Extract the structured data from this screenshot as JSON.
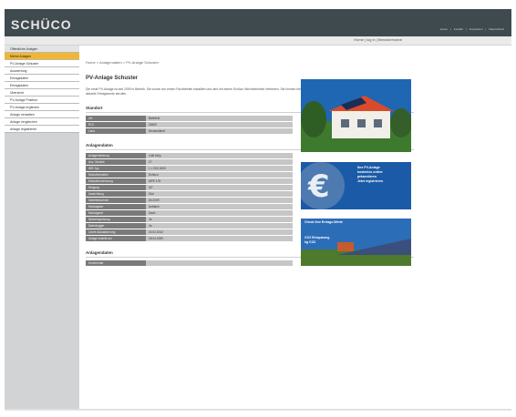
{
  "brand": {
    "logo": "SCHÜCO"
  },
  "header": {
    "topnav": [
      "Home",
      "Kontakt",
      "Impressum",
      "Datenschutz"
    ],
    "user_info": "Home | log in | Benutzername"
  },
  "sidebar": {
    "items": [
      {
        "label": "Öffentliche Anlagen",
        "active": false
      },
      {
        "label": "Meine Anlagen",
        "active": true
      },
      {
        "label": "PV-Anlage Schuster",
        "active": false
      },
      {
        "label": "Auswertung",
        "active": false
      },
      {
        "label": "Ertragsdaten",
        "active": false
      },
      {
        "label": "Ertragsdaten",
        "active": false
      },
      {
        "label": "Übersicht",
        "active": false
      },
      {
        "label": "PV-Anlage Position",
        "active": false
      },
      {
        "label": "PV-Anlage ergänzen",
        "active": false
      },
      {
        "label": "Anlage verwalten",
        "active": false
      },
      {
        "label": "Anlage vergleichen",
        "active": false
      },
      {
        "label": "Anlage registrieren",
        "active": false
      }
    ]
  },
  "breadcrumb": "Home > Anlagendaten > PV-Anlage Schuster",
  "page_title": "PV-Anlage Schuster",
  "intro": "Die erste PV-Anlage ist seit 2009 in Betrieb. Sie wurde von einem Fachbetrieb installiert und wird mit einem Schüco Wechselrichter betrieben. Sie können hier aktuelle Ertragswerte abrufen.",
  "standort": {
    "title": "Standort",
    "rows": [
      {
        "k": "Ort",
        "v": "Bielefeld"
      },
      {
        "k": "PLZ",
        "v": "33609"
      },
      {
        "k": "Land",
        "v": "Deutschland"
      }
    ]
  },
  "anlagendaten": {
    "title": "Anlagendaten",
    "rows": [
      {
        "k": "Anlagenleistung",
        "v": "4,68 kWp"
      },
      {
        "k": "Anz. Module",
        "v": "27"
      },
      {
        "k": "WR-Typ",
        "v": "1 × SGI 4000"
      },
      {
        "k": "Modulhersteller",
        "v": "Schüco"
      },
      {
        "k": "Modulbezeichnung",
        "v": "MPE 175"
      },
      {
        "k": "Neigung",
        "v": "30°"
      },
      {
        "k": "Ausrichtung",
        "v": "Süd"
      },
      {
        "k": "Inbetriebnahme",
        "v": "04.2009"
      },
      {
        "k": "Montageart",
        "v": "Aufdach"
      },
      {
        "k": "Montageort",
        "v": "Dach"
      },
      {
        "k": "Netzeinspeisung",
        "v": "Ja"
      },
      {
        "k": "Datenlogger",
        "v": "Ja"
      },
      {
        "k": "Letzte Aktualisierung",
        "v": "20.02.2012"
      },
      {
        "k": "Anlage erstellt am",
        "v": "28.04.2009"
      }
    ]
  },
  "kommentare": {
    "title": "Anlagendaten",
    "rows": [
      {
        "k": "Kommentar",
        "v": ""
      }
    ]
  },
  "banners": {
    "ad1": [
      "Ihre PV-Anlage",
      "kostenlos online",
      "präsentieren",
      "Jetzt registrieren"
    ],
    "ad2": [
      "Check Ihre Ertrags-Werte",
      "CO2 Einsparung",
      "kg CO2"
    ]
  },
  "colors": {
    "header": "#3f4a4f",
    "active": "#f2b630",
    "sidebar": "#d1d3d5",
    "table_key": "#7a7a7a",
    "table_val": "#c6c6c6"
  }
}
